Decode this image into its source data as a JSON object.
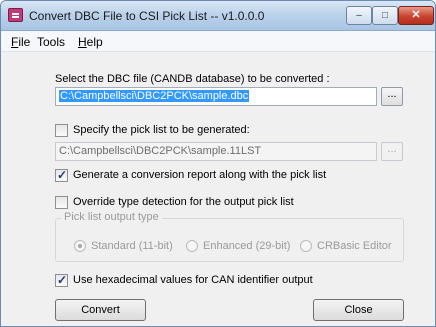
{
  "window": {
    "title": "Convert DBC File to CSI Pick List -- v1.0.0.0",
    "min_glyph": "–",
    "max_glyph": "□",
    "close_glyph": "✕"
  },
  "menu": {
    "file_mnemonic": "F",
    "file_rest": "ile",
    "tools": "Tools",
    "help_mnemonic": "H",
    "help_rest": "elp"
  },
  "dbc": {
    "label": "Select the DBC file (CANDB database) to be converted :",
    "value": "C:\\Campbellsci\\DBC2PCK\\sample.dbc",
    "browse_label": "..."
  },
  "picklist": {
    "checkbox_label": "Specify the pick list to be generated:",
    "checked": false,
    "value": "C:\\Campbellsci\\DBC2PCK\\sample.11LST",
    "browse_label": "..."
  },
  "report": {
    "checkbox_label": "Generate a conversion report along with the pick list",
    "checked": true
  },
  "override": {
    "checkbox_label": "Override type detection for the output pick list",
    "checked": false
  },
  "output_type": {
    "legend": "Pick list output type",
    "options": [
      {
        "label": "Standard (11-bit)",
        "selected": true
      },
      {
        "label": "Enhanced (29-bit)",
        "selected": false
      },
      {
        "label": "CRBasic Editor",
        "selected": false
      }
    ]
  },
  "hex": {
    "checkbox_label": "Use hexadecimal values for CAN identifier output",
    "checked": true
  },
  "buttons": {
    "convert": "Convert",
    "close": "Close"
  }
}
